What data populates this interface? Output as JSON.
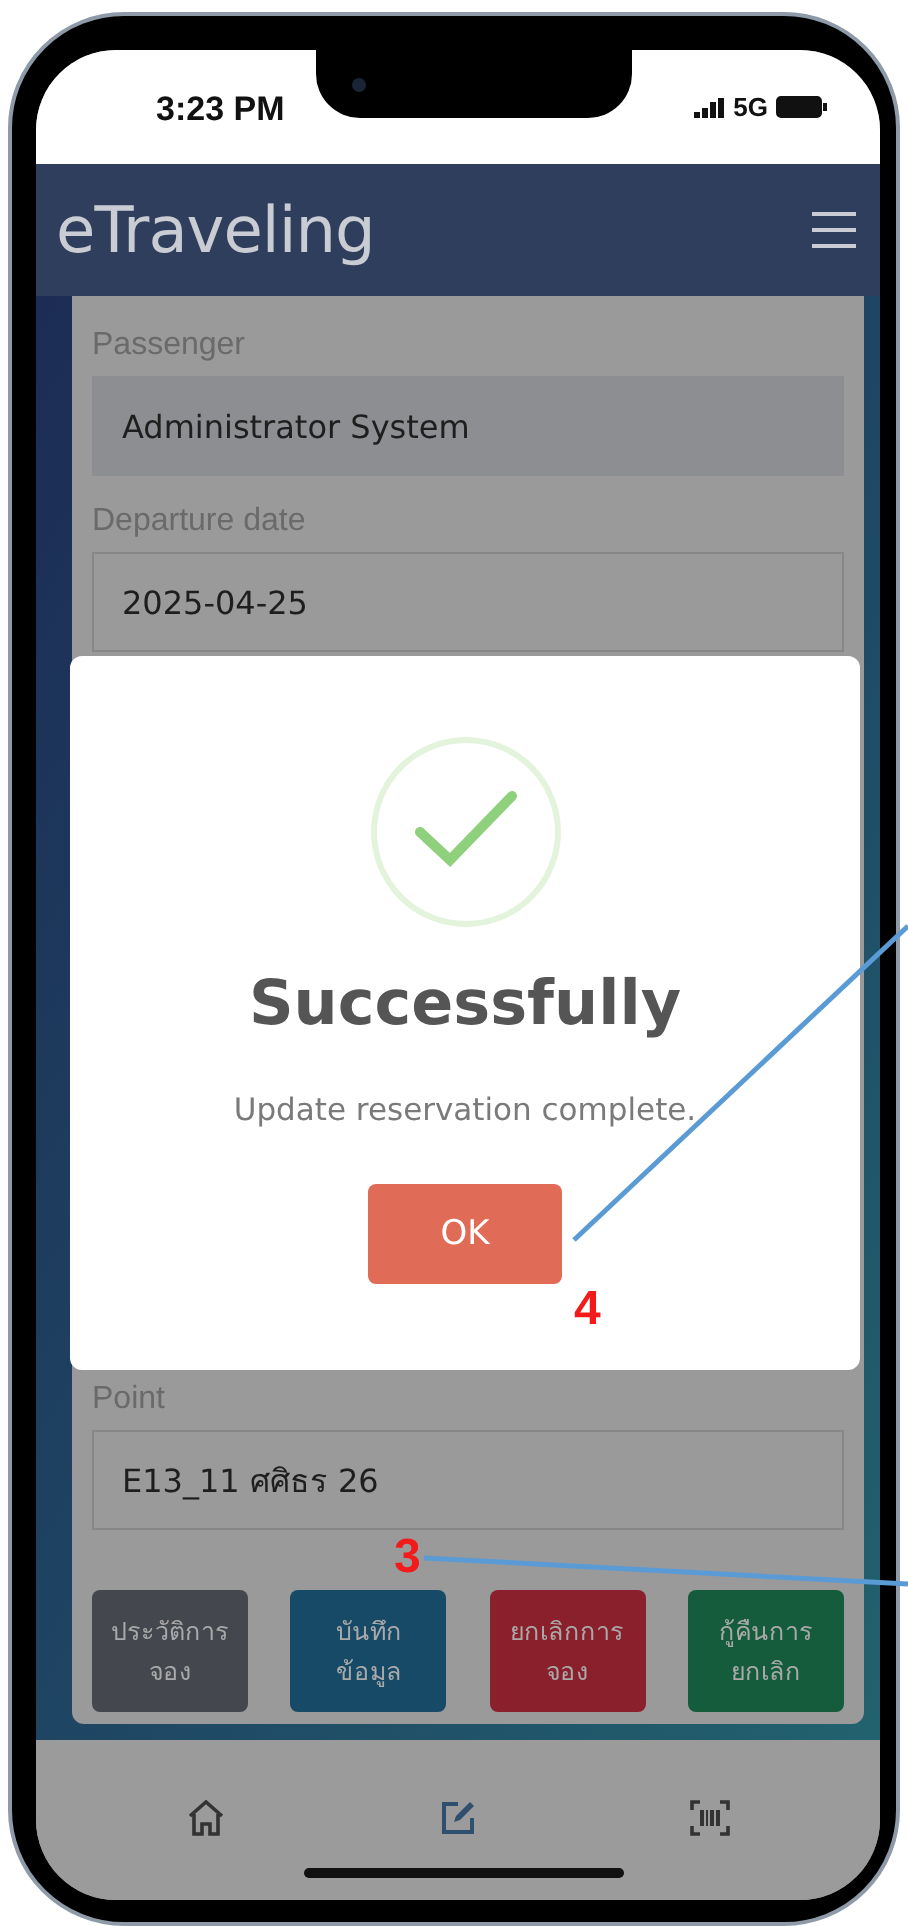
{
  "status_bar": {
    "time": "3:23 PM",
    "network": "5G"
  },
  "header": {
    "title": "eTraveling"
  },
  "form": {
    "fields": [
      {
        "label": "Passenger",
        "value": "Administrator  System",
        "kind": "readonly"
      },
      {
        "label": "Departure date",
        "value": "2025-04-25",
        "kind": "input"
      },
      {
        "label": "Point",
        "value": "E13_11 ศศิธร 26",
        "kind": "input"
      }
    ]
  },
  "actions": [
    {
      "lines": [
        "ประวัติการ",
        "จอง"
      ],
      "color": "#44484e"
    },
    {
      "lines": [
        "บันทึก",
        "ข้อมูล"
      ],
      "color": "#164a66"
    },
    {
      "lines": [
        "ยกเลิกการ",
        "จอง"
      ],
      "color": "#8a202b"
    },
    {
      "lines": [
        "กู้คืนการ",
        "ยกเลิก"
      ],
      "color": "#155c3c"
    }
  ],
  "dialog": {
    "title": "Successfully",
    "message": "Update reservation complete.",
    "button": "OK"
  },
  "annotations": [
    {
      "label": "3"
    },
    {
      "label": "4"
    }
  ]
}
